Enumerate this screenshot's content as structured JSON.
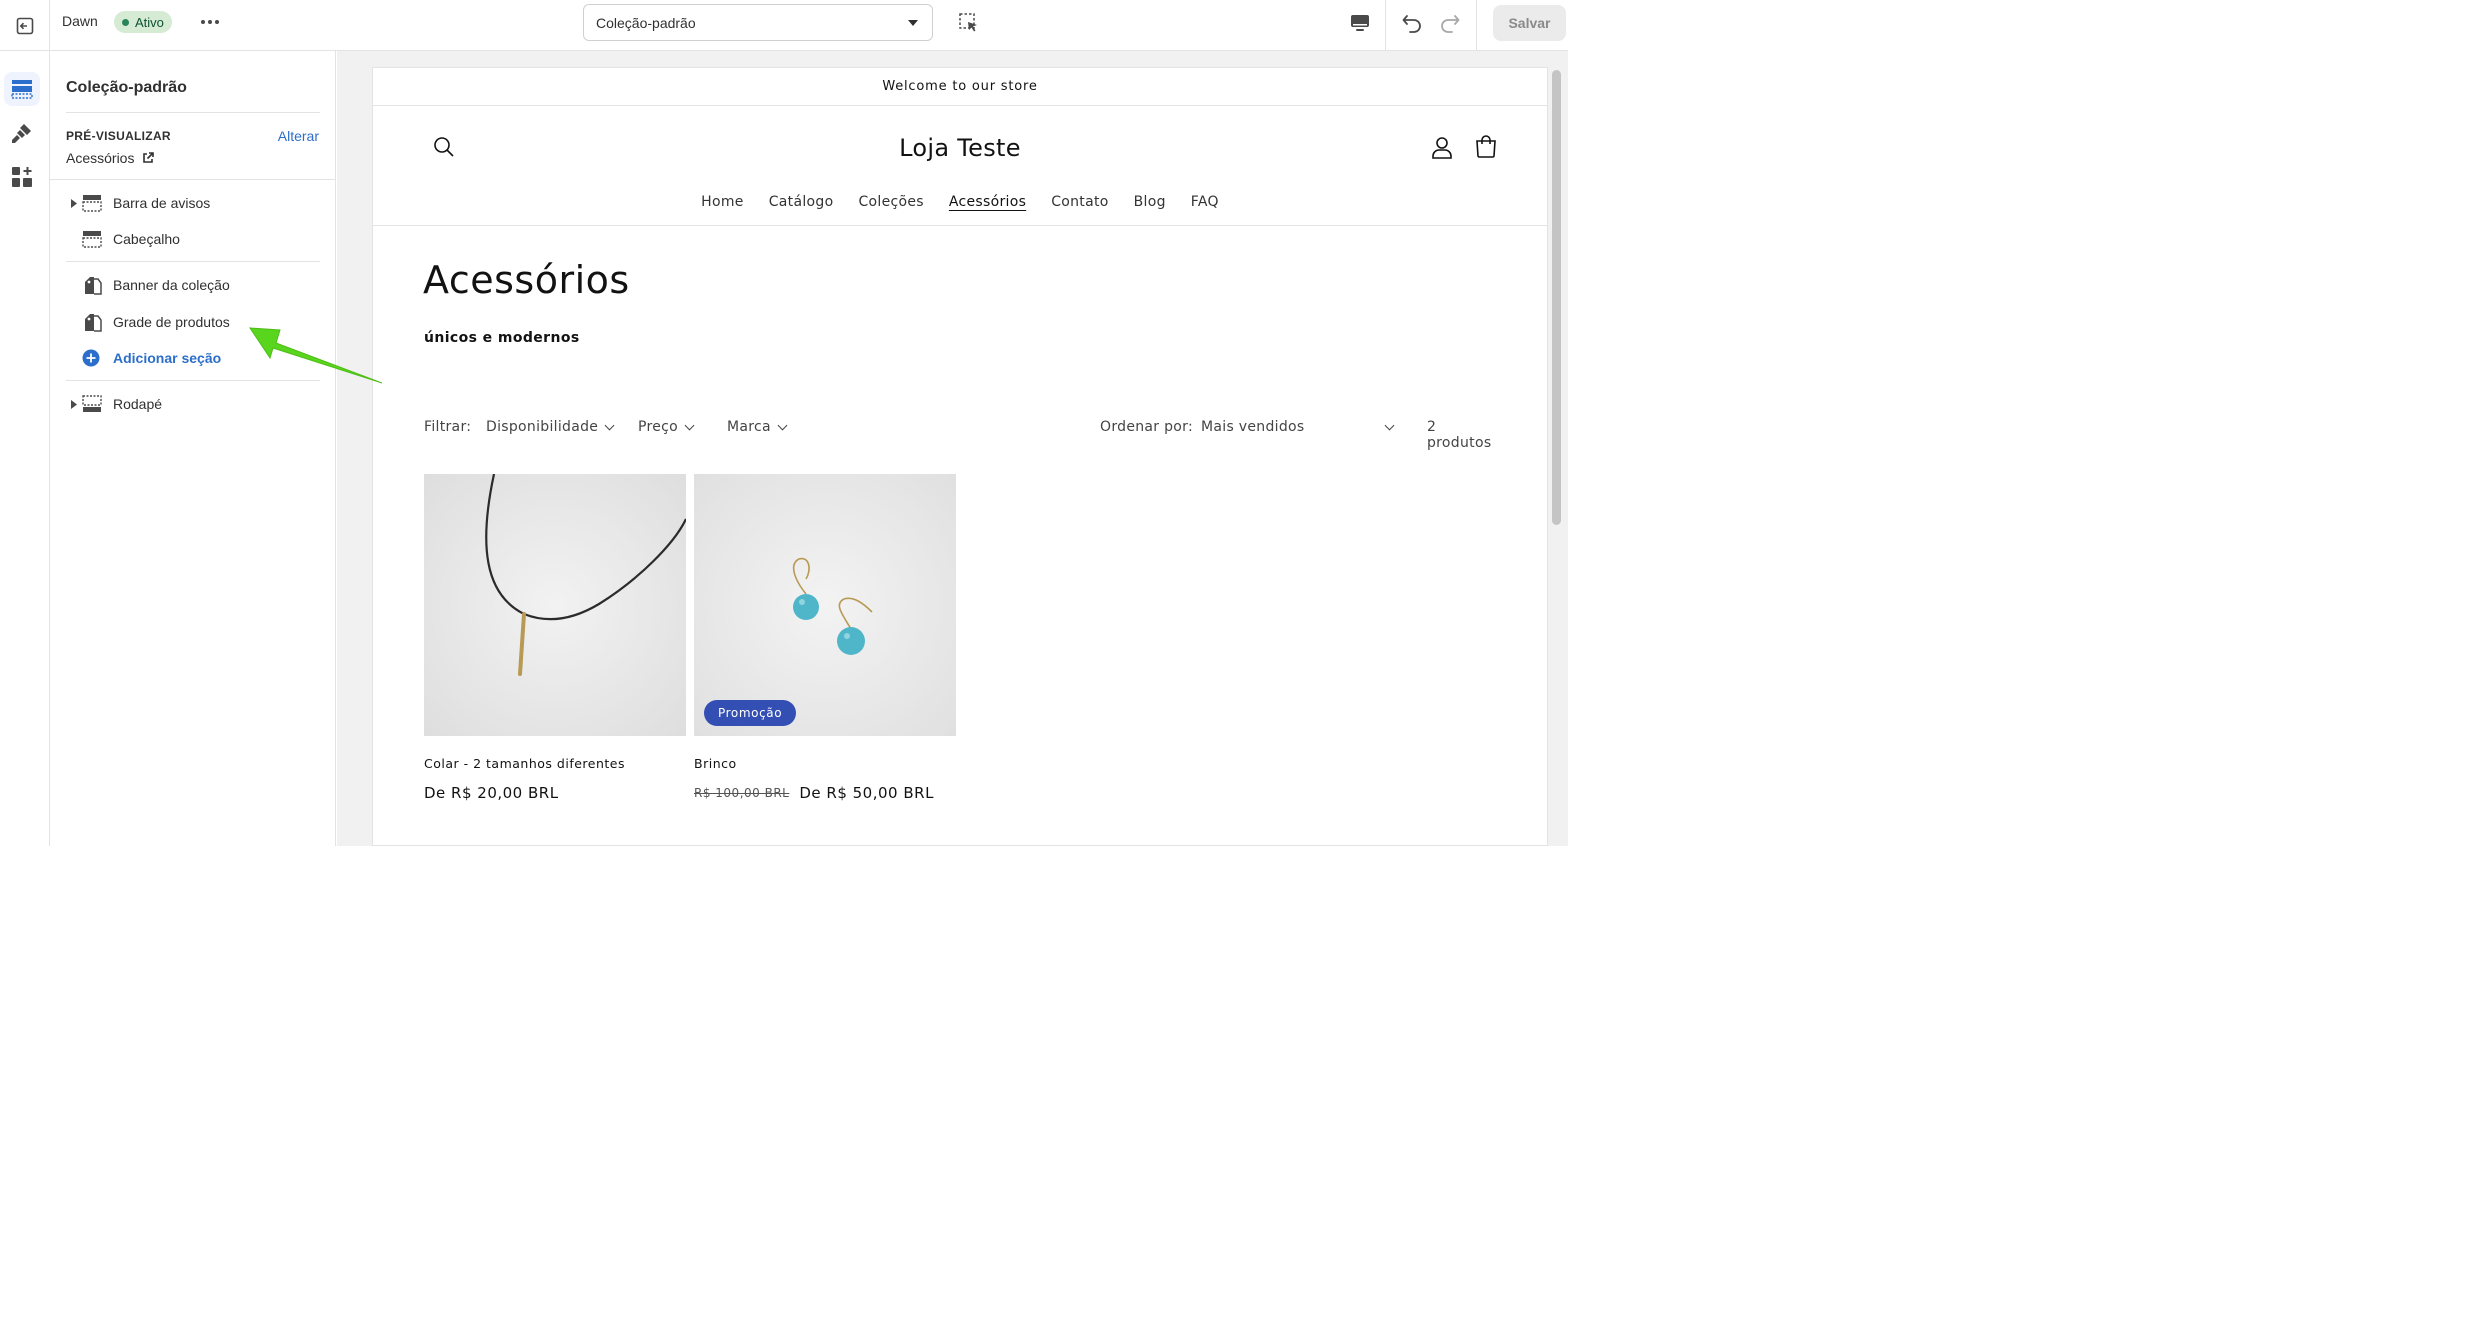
{
  "topbar": {
    "theme_name": "Dawn",
    "status_badge": "Ativo",
    "template_select": "Coleção-padrão",
    "save_label": "Salvar"
  },
  "sidebar": {
    "title": "Coleção-padrão",
    "preview_label": "PRÉ-VISUALIZAR",
    "preview_change": "Alterar",
    "preview_value": "Acessórios",
    "sections": {
      "announcement": "Barra de avisos",
      "header": "Cabeçalho",
      "banner": "Banner da coleção",
      "product_grid": "Grade de produtos",
      "add_section": "Adicionar seção",
      "footer": "Rodapé"
    }
  },
  "store": {
    "announcement": "Welcome to our store",
    "logo": "Loja Teste",
    "nav": [
      "Home",
      "Catálogo",
      "Coleções",
      "Acessórios",
      "Contato",
      "Blog",
      "FAQ"
    ],
    "active_nav": "Acessórios",
    "collection_title": "Acessórios",
    "collection_description": "únicos e modernos",
    "filter_label": "Filtrar:",
    "filters": [
      "Disponibilidade",
      "Preço",
      "Marca"
    ],
    "sort_label": "Ordenar por:",
    "sort_value": "Mais vendidos",
    "product_count": "2 produtos",
    "products": [
      {
        "name": "Colar - 2 tamanhos diferentes",
        "price": "De R$ 20,00 BRL",
        "old_price": "",
        "badge": ""
      },
      {
        "name": "Brinco",
        "price": "De R$ 50,00 BRL",
        "old_price": "R$ 100,00 BRL",
        "badge": "Promoção"
      }
    ]
  },
  "colors": {
    "accent_blue": "#2c6ecb",
    "status_green": "#29845a",
    "sale_badge": "#334fb4",
    "annotation_arrow": "#5ad51e"
  }
}
